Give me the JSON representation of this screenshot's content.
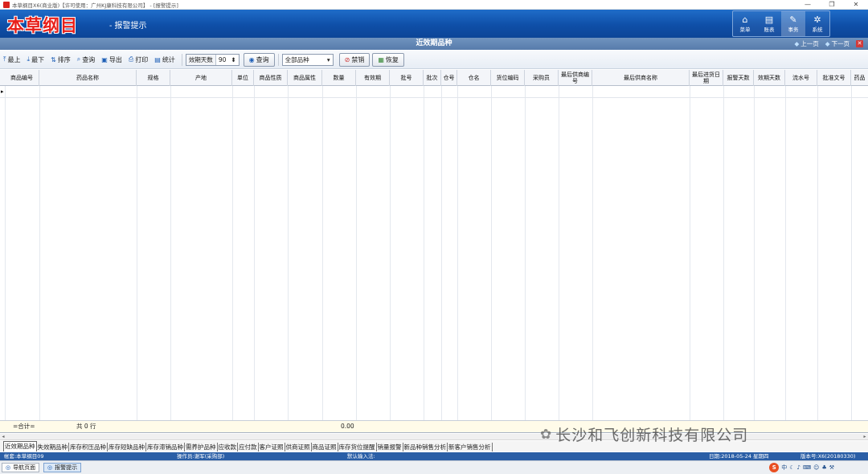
{
  "window": {
    "title": "本草纲目X6(商业版)【许可使用：广州KJ康科技有限公司】 - [报警提示]",
    "controls": [
      "—",
      "❐",
      "✕"
    ]
  },
  "banner": {
    "logo": "本草纲目",
    "subtitle": "- 报警提示",
    "nav": [
      {
        "label": "菜单",
        "icon": "home-icon",
        "glyph": "⌂"
      },
      {
        "label": "账表",
        "icon": "book-icon",
        "glyph": "▤"
      },
      {
        "label": "事务",
        "icon": "edit-icon",
        "glyph": "✎"
      },
      {
        "label": "系统",
        "icon": "gear-icon",
        "glyph": "✲"
      }
    ]
  },
  "caption": {
    "title": "近效期品种",
    "prev": "上一页",
    "next": "下一页"
  },
  "toolbar": {
    "top": "最上",
    "bottom": "最下",
    "sort": "排序",
    "query": "查询",
    "export": "导出",
    "print": "打印",
    "stats": "统计",
    "days_label": "效期天数",
    "days_value": "90",
    "search_btn": "查询",
    "category": "全部品种",
    "ban": "禁销",
    "restore": "恢复"
  },
  "grid": {
    "columns": [
      "商品编号",
      "药品名称",
      "规格",
      "产地",
      "单位",
      "商品性质",
      "商品属性",
      "数量",
      "有效期",
      "批号",
      "批次",
      "仓号",
      "仓名",
      "货位编码",
      "采购员",
      "最后供商编号",
      "最后供商名称",
      "最后进货日期",
      "报警天数",
      "效期天数",
      "流水号",
      "批准文号",
      "药品"
    ],
    "row_indicator": "▸",
    "total_label": "=合计=",
    "total_rows": "共 0 行",
    "total_qty": "0.00"
  },
  "tabs": [
    "近效期品种",
    "失效期品种",
    "库存积压品种",
    "库存短缺品种",
    "库存滞销品种",
    "需养护品种",
    "应收款",
    "应付款",
    "客户证照",
    "供商证照",
    "商品证照",
    "库存货位提醒",
    "销量报警",
    "新品种销售分析",
    "新客户销售分析"
  ],
  "status": {
    "account": "帐套:本草纲目09",
    "operator": "操作员:谢军(采购部)",
    "input_method": "默认输入法:",
    "date": "日期:2018-05-24 星期四",
    "version": "版本号:X6(20180330)"
  },
  "taskbar": {
    "nav_page": "导航页面",
    "alert": "报警提示"
  },
  "tray": {
    "ime": "S",
    "lang": "中"
  },
  "watermark": "长沙和飞创新科技有限公司",
  "colors": {
    "banner": "#0f4fa8",
    "caption": "#587cab",
    "logo": "#e8201a",
    "status": "#2a5ea6"
  }
}
